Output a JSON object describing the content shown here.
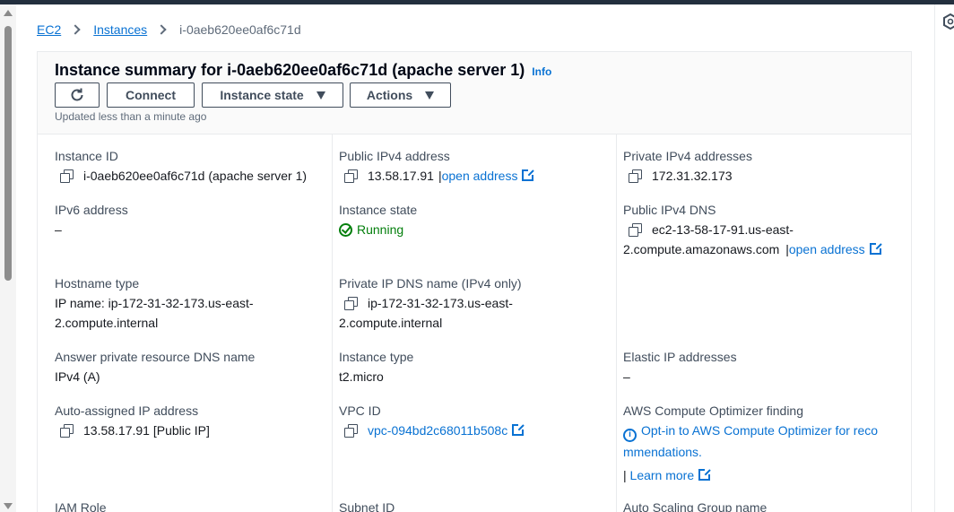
{
  "breadcrumb": {
    "ec2": "EC2",
    "instances": "Instances",
    "current": "i-0aeb620ee0af6c71d"
  },
  "summary": {
    "title": "Instance summary for i-0aeb620ee0af6c71d (apache server 1)",
    "info": "Info",
    "updated": "Updated less than a minute ago"
  },
  "toolbar": {
    "connect": "Connect",
    "instance_state": "Instance state",
    "actions": "Actions"
  },
  "fields": {
    "instance_id": {
      "label": "Instance ID",
      "value": "i-0aeb620ee0af6c71d (apache server 1)"
    },
    "public_ipv4": {
      "label": "Public IPv4 address",
      "value": "13.58.17.91",
      "sep": "|",
      "link": "open address"
    },
    "private_ipv4": {
      "label": "Private IPv4 addresses",
      "value": "172.31.32.173"
    },
    "ipv6": {
      "label": "IPv6 address",
      "value": "–"
    },
    "instance_state": {
      "label": "Instance state",
      "value": "Running"
    },
    "public_dns": {
      "label": "Public IPv4 DNS",
      "value_line1": "ec2-13-58-17-91.us-east-",
      "value_line2": "2.compute.amazonaws.com",
      "sep": "|",
      "link": "open address"
    },
    "hostname_type": {
      "label": "Hostname type",
      "value_line1": "IP name: ip-172-31-32-173.us-east-",
      "value_line2": "2.compute.internal"
    },
    "private_dns": {
      "label": "Private IP DNS name (IPv4 only)",
      "value_line1": "ip-172-31-32-173.us-east-",
      "value_line2": "2.compute.internal"
    },
    "answer_dns": {
      "label": "Answer private resource DNS name",
      "value": "IPv4 (A)"
    },
    "instance_type": {
      "label": "Instance type",
      "value": "t2.micro"
    },
    "elastic_ip": {
      "label": "Elastic IP addresses",
      "value": "–"
    },
    "auto_ip": {
      "label": "Auto-assigned IP address",
      "value": "13.58.17.91 [Public IP]"
    },
    "vpc_id": {
      "label": "VPC ID",
      "value": "vpc-094bd2c68011b508c"
    },
    "optimizer": {
      "label": "AWS Compute Optimizer finding",
      "line1": "Opt-in to AWS Compute Optimizer for reco",
      "line2": "mmendations.",
      "sep": "|",
      "learn_more": "Learn more"
    },
    "iam_role": {
      "label": "IAM Role"
    },
    "subnet_id": {
      "label": "Subnet ID"
    },
    "asg_name": {
      "label": "Auto Scaling Group name"
    }
  },
  "colors": {
    "link": "#0972d3",
    "running": "#037f0c",
    "topbar": "#232f3e"
  },
  "icons": [
    "refresh-icon",
    "copy-icon",
    "external-link-icon",
    "status-check-icon",
    "info-icon",
    "chevron-right-icon",
    "caret-down-icon",
    "hexagon-icon"
  ]
}
